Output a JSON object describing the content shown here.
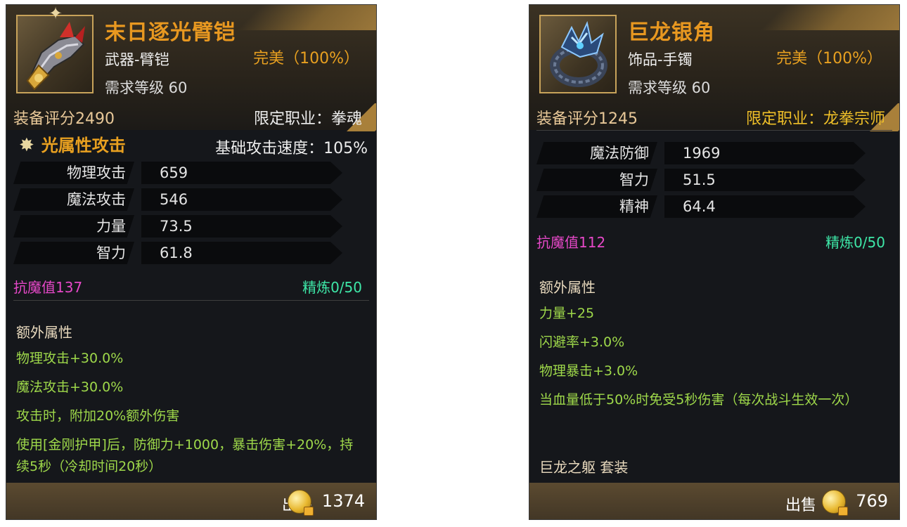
{
  "left": {
    "title": "末日逐光臂铠",
    "type": "武器-臂铠",
    "quality": "完美（100%）",
    "required_level": "需求等级 60",
    "score": "装备评分2490",
    "job": "限定职业：拳魂",
    "element": "光属性攻击",
    "attack_speed": "基础攻击速度：105%",
    "stats": [
      {
        "label": "物理攻击",
        "value": "659"
      },
      {
        "label": "魔法攻击",
        "value": "546"
      },
      {
        "label": "力量",
        "value": "73.5"
      },
      {
        "label": "智力",
        "value": "61.8"
      }
    ],
    "resist": "抗魔值137",
    "refine": "精炼0/50",
    "extra_title": "额外属性",
    "extras": [
      "物理攻击+30.0%",
      "魔法攻击+30.0%",
      "攻击时，附加20%额外伤害",
      "使用[金刚护甲]后，防御力+1000，暴击伤害+20%，持续5秒（冷却时间20秒）"
    ],
    "sell_label": "出售",
    "price": "1374"
  },
  "right": {
    "title": "巨龙银角",
    "type": "饰品-手镯",
    "quality": "完美（100%）",
    "required_level": "需求等级 60",
    "score": "装备评分1245",
    "job": "限定职业：龙拳宗师",
    "stats": [
      {
        "label": "魔法防御",
        "value": "1969"
      },
      {
        "label": "智力",
        "value": "51.5"
      },
      {
        "label": "精神",
        "value": "64.4"
      }
    ],
    "resist": "抗魔值112",
    "refine": "精炼0/50",
    "extra_title": "额外属性",
    "extras": [
      "力量+25",
      "闪避率+3.0%",
      "物理暴击+3.0%",
      "当血量低于50%时免受5秒伤害（每次战斗生效一次）"
    ],
    "set_title": "巨龙之躯 套装",
    "sell_label": "出售",
    "price": "769"
  },
  "icons": {
    "left_item": "gauntlet-icon",
    "right_item": "dragon-bracelet-icon",
    "element": "light-element-icon",
    "currency": "gold-coin-icon"
  },
  "colors": {
    "title": "#e89820",
    "quality": "#e8a020",
    "resist": "#e648c8",
    "refine": "#3ee8a8",
    "extra": "#9ed84a"
  }
}
